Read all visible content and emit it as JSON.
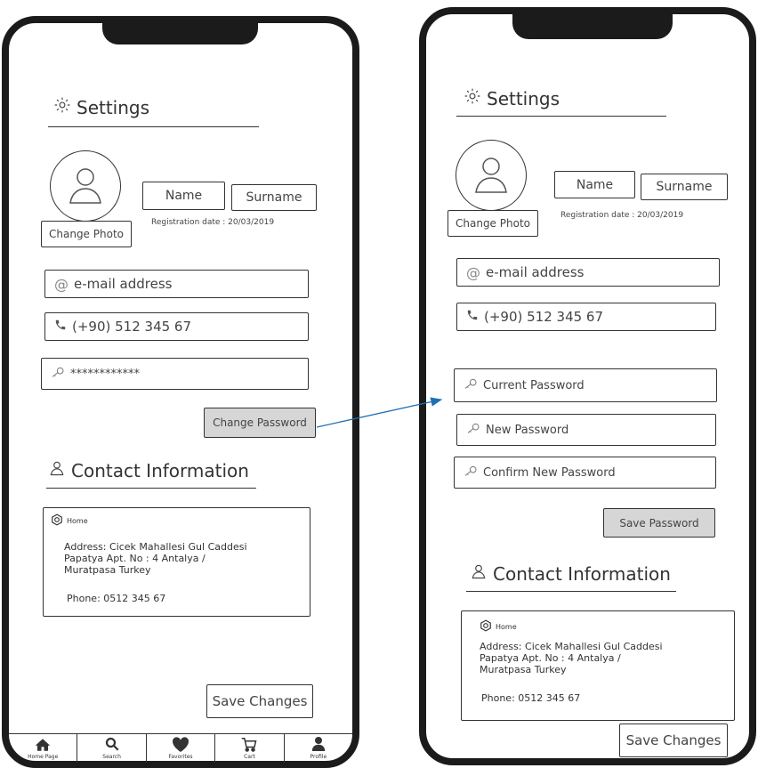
{
  "settings_title": "Settings",
  "profile": {
    "change_photo": "Change Photo",
    "name": "Name",
    "surname": "Surname",
    "registration": "Registration date : 20/03/2019"
  },
  "fields": {
    "email_placeholder": "e-mail address",
    "phone": "(+90) 512 345 67",
    "password_masked": "************"
  },
  "buttons": {
    "change_password": "Change Password",
    "save_password": "Save Password",
    "save_changes": "Save Changes"
  },
  "password_fields": {
    "current": "Current Password",
    "new": "New Password",
    "confirm": "Confirm New Password"
  },
  "contact": {
    "title": "Contact Information",
    "label": "Home",
    "address": "Address: Cicek Mahallesi Gul Caddesi\nPapatya Apt. No : 4 Antalya /\nMuratpasa Turkey",
    "phone": "Phone: 0512 345 67"
  },
  "tabs": [
    {
      "label": "Home Page",
      "icon": "home-icon"
    },
    {
      "label": "Search",
      "icon": "search-icon"
    },
    {
      "label": "Favorites",
      "icon": "heart-icon"
    },
    {
      "label": "Cart",
      "icon": "cart-icon"
    },
    {
      "label": "Profile",
      "icon": "profile-icon"
    }
  ],
  "colors": {
    "frame": "#1b1b1b",
    "button_gray": "#d6d6d6",
    "arrow": "#1f6fb5"
  }
}
